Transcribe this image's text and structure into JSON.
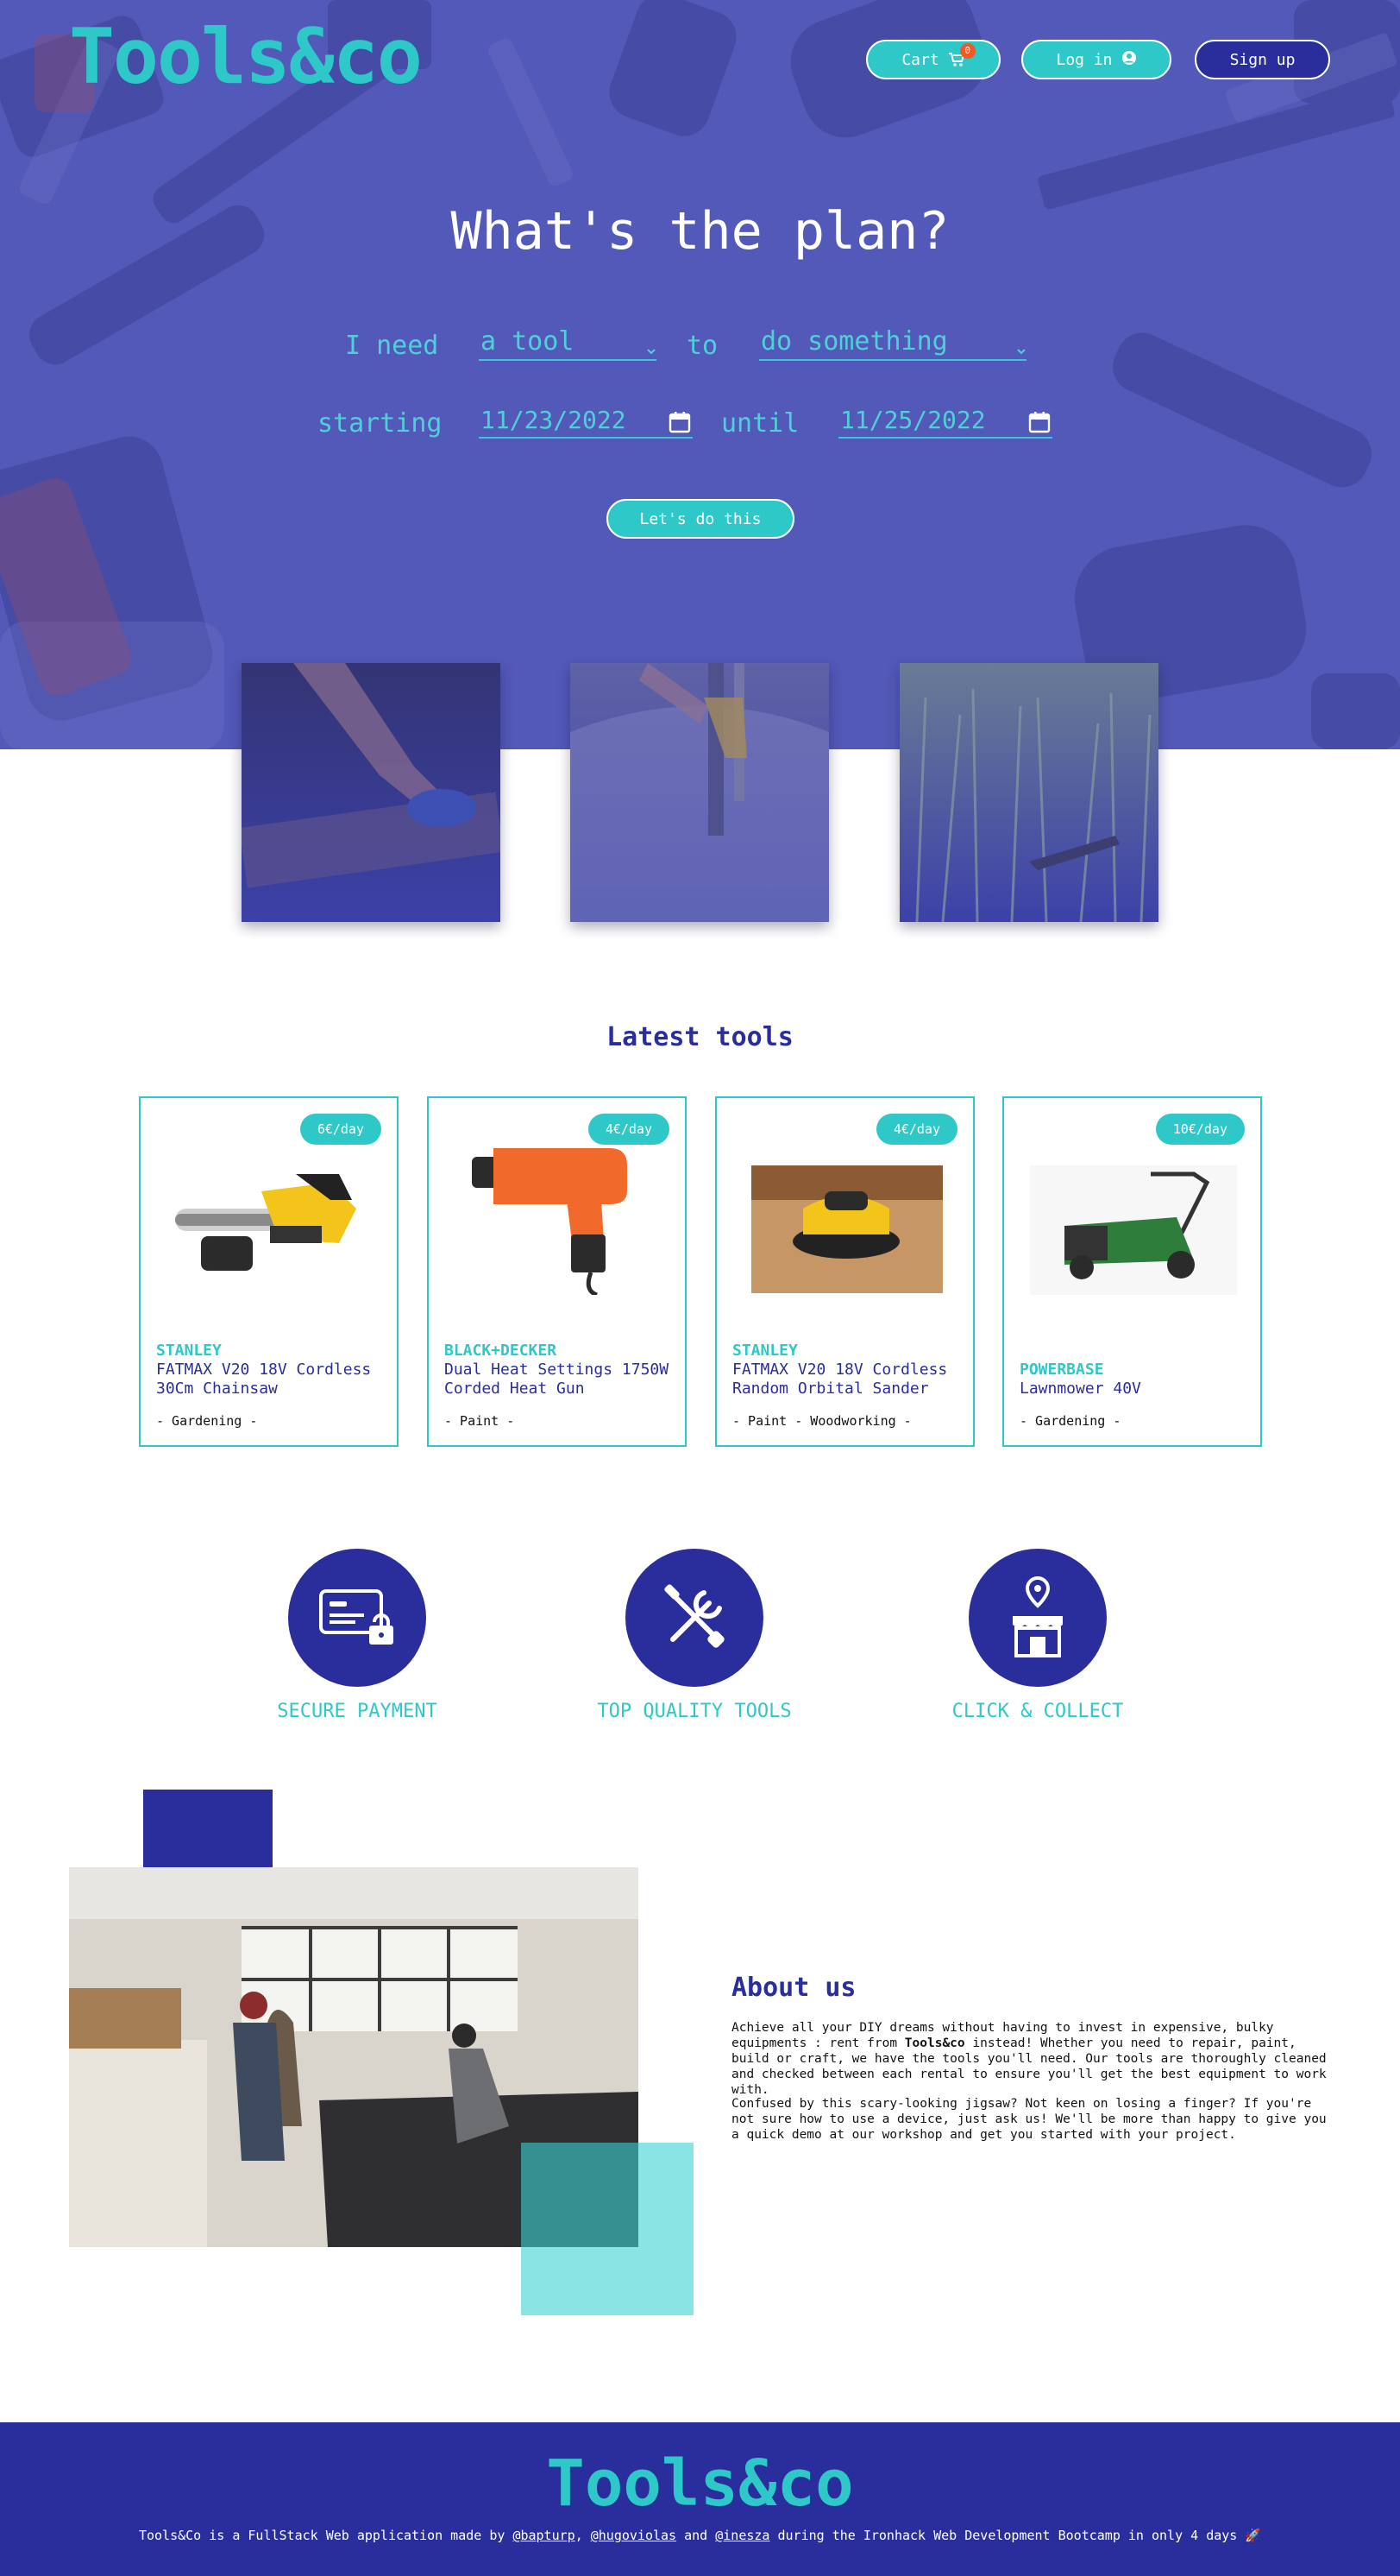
{
  "brand": {
    "logo": "Tools&co"
  },
  "nav": {
    "cart_label": "Cart",
    "cart_count": "0",
    "login_label": "Log in",
    "signup_label": "Sign up"
  },
  "hero": {
    "title": "What's the plan?",
    "i_need": "I need",
    "tool_select": "a tool",
    "to": "to",
    "action_select": "do something",
    "starting": "starting",
    "start_date": "11/23/2022",
    "until": "until",
    "end_date": "11/25/2022",
    "cta_label": "Let's do this"
  },
  "latest": {
    "title": "Latest tools",
    "items": [
      {
        "price": "6€/day",
        "brand": "STANLEY",
        "name": "FATMAX V20 18V Cordless 30Cm Chainsaw",
        "tags": "- Gardening -"
      },
      {
        "price": "4€/day",
        "brand": "BLACK+DECKER",
        "name": "Dual Heat Settings 1750W Corded Heat Gun",
        "tags": "- Paint -"
      },
      {
        "price": "4€/day",
        "brand": "STANLEY",
        "name": "FATMAX V20 18V Cordless Random Orbital Sander",
        "tags": "- Paint - Woodworking -"
      },
      {
        "price": "10€/day",
        "brand": "POWERBASE",
        "name": "Lawnmower 40V",
        "tags": "- Gardening -"
      }
    ]
  },
  "features": [
    {
      "label": "SECURE PAYMENT",
      "icon": "credit-card-lock-icon"
    },
    {
      "label": "TOP QUALITY TOOLS",
      "icon": "wrench-screwdriver-icon"
    },
    {
      "label": "CLICK & COLLECT",
      "icon": "store-pin-icon"
    }
  ],
  "about": {
    "title": "About us",
    "p1_a": "Achieve all your DIY dreams without having to invest in expensive, bulky equipments : rent from ",
    "p1_brand": "Tools&co",
    "p1_b": " instead! Whether you need to repair, paint, build or craft, we have the tools you'll need. Our tools are thoroughly cleaned and checked between each rental to ensure you'll get the best equipment to work with.",
    "p2": "Confused by this scary-looking jigsaw? Not keen on losing a finger? If you're not sure how to use a device, just ask us! We'll be more than happy to give you a quick demo at our workshop and get you started with your project."
  },
  "footer": {
    "logo": "Tools&co",
    "text_a": "Tools&Co is a FullStack Web application made by ",
    "link1": "@bapturp",
    "sep1": ", ",
    "link2": "@hugoviolas",
    "sep2": " and ",
    "link3": "@inesza",
    "text_b": " during the Ironhack Web Development Bootcamp in only 4 days 🚀"
  },
  "colors": {
    "teal": "#2ec8c8",
    "navy": "#2a2d9c",
    "hero_overlay": "#5056b4",
    "badge": "#f05a28"
  }
}
